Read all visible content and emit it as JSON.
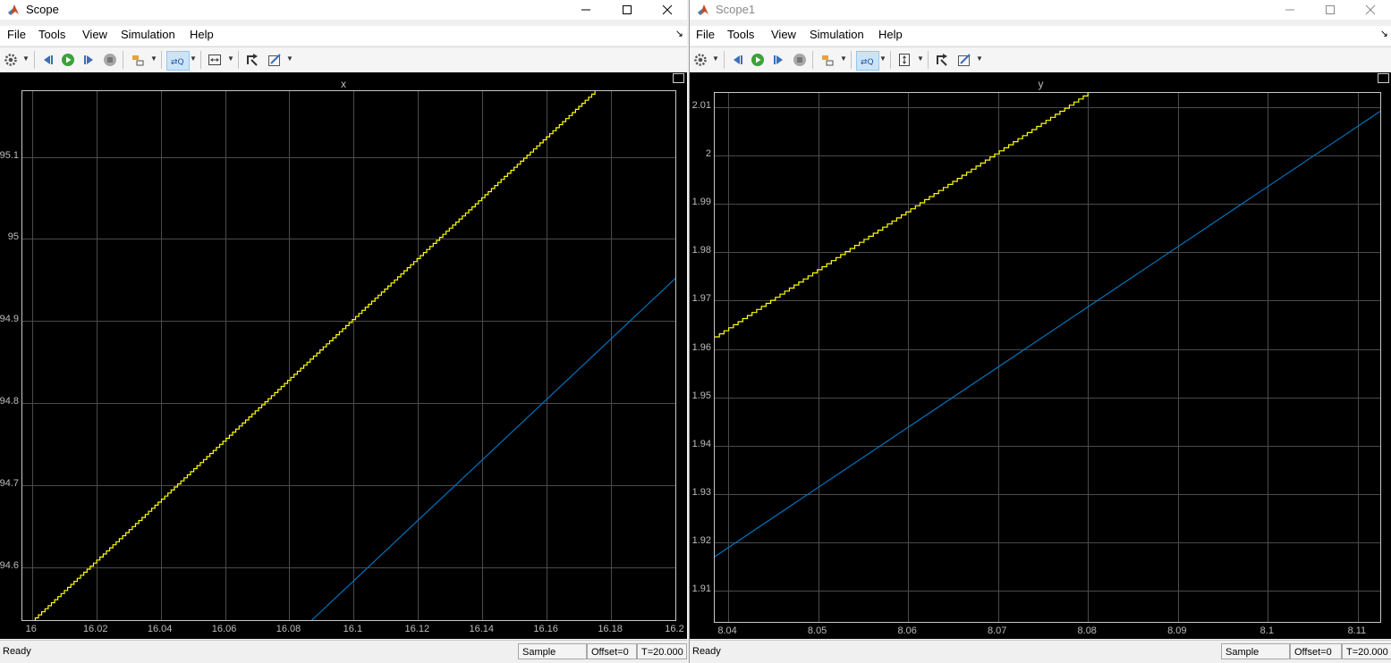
{
  "windows": [
    {
      "id": "scope",
      "title": "Scope",
      "menu": [
        "File",
        "Tools",
        "View",
        "Simulation",
        "Help"
      ],
      "axes_title": "x",
      "status": {
        "ready": "Ready",
        "sample": "Sample based",
        "offset": "Offset=0",
        "time": "T=20.000"
      },
      "chart_data": {
        "type": "line",
        "title": "x",
        "xlim": [
          15.997,
          16.2
        ],
        "ylim": [
          94.536,
          95.18
        ],
        "xticks": [
          "16",
          "16.02",
          "16.04",
          "16.06",
          "16.08",
          "16.1",
          "16.12",
          "16.14",
          "16.16",
          "16.18",
          "16.2"
        ],
        "yticks": [
          "94.6",
          "94.7",
          "94.8",
          "94.9",
          "95",
          "95.1"
        ],
        "grid": true,
        "series": [
          {
            "color": "#ffff00",
            "style": "staircase",
            "x": [
              16.0,
              16.175
            ],
            "y": [
              94.535,
              95.18
            ]
          },
          {
            "color": "#0072bd",
            "style": "line",
            "x": [
              16.087,
              16.2
            ],
            "y": [
              94.536,
              94.952
            ]
          }
        ]
      }
    },
    {
      "id": "scope1",
      "title": "Scope1",
      "menu": [
        "File",
        "Tools",
        "View",
        "Simulation",
        "Help"
      ],
      "axes_title": "y",
      "status": {
        "ready": "Ready",
        "sample": "Sample based",
        "offset": "Offset=0",
        "time": "T=20.000"
      },
      "chart_data": {
        "type": "line",
        "title": "y",
        "xlim": [
          8.0385,
          8.1125
        ],
        "ylim": [
          1.9035,
          2.013
        ],
        "xticks": [
          "8.04",
          "8.05",
          "8.06",
          "8.07",
          "8.08",
          "8.09",
          "8.1",
          "8.11"
        ],
        "yticks": [
          "1.91",
          "1.92",
          "1.93",
          "1.94",
          "1.95",
          "1.96",
          "1.97",
          "1.98",
          "1.99",
          "2",
          "2.01"
        ],
        "grid": true,
        "series": [
          {
            "color": "#ffff00",
            "style": "staircase",
            "x": [
              8.0385,
              8.08
            ],
            "y": [
              1.9625,
              2.013
            ]
          },
          {
            "color": "#0072bd",
            "style": "line",
            "x": [
              8.0385,
              8.1125
            ],
            "y": [
              1.917,
              2.0092
            ]
          }
        ]
      }
    }
  ]
}
